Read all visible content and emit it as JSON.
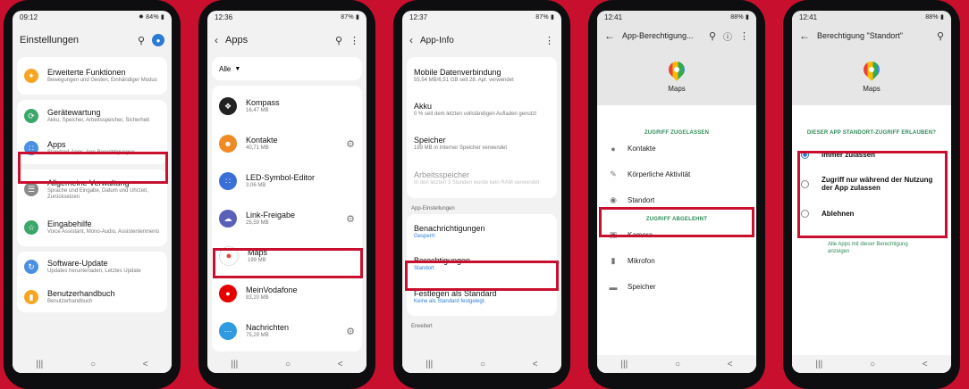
{
  "colors": {
    "frame": "#c8102e",
    "highlight": "#c8102e",
    "link": "#2b7bd6",
    "section_green": "#2e8b57"
  },
  "phone1": {
    "status": {
      "time": "09:12",
      "right": "✹ 84% ▮"
    },
    "title": "Einstellungen",
    "items": [
      {
        "title": "Erweiterte Funktionen",
        "sub": "Bewegungen und Gesten, Einhändiger Modus",
        "icon": "star-icon"
      },
      {
        "title": "Gerätewartung",
        "sub": "Akku, Speicher, Arbeitsspeicher, Sicherheit",
        "icon": "maintenance-icon"
      },
      {
        "title": "Apps",
        "sub": "Standard-Apps, App-Berechtigungen",
        "icon": "apps-grid-icon"
      },
      {
        "title": "Allgemeine Verwaltung",
        "sub": "Sprache und Eingabe, Datum und Uhrzeit, Zurücksetzen",
        "icon": "sliders-icon"
      },
      {
        "title": "Eingabehilfe",
        "sub": "Voice Assistant, Mono-Audio, Assistentenmenü",
        "icon": "accessibility-icon"
      },
      {
        "title": "Software-Update",
        "sub": "Updates herunterladen, Letztes Update",
        "icon": "update-icon"
      },
      {
        "title": "Benutzerhandbuch",
        "sub": "Benutzerhandbuch",
        "icon": "manual-icon"
      }
    ]
  },
  "phone2": {
    "status": {
      "time": "12:36",
      "right": "87% ▮"
    },
    "title": "Apps",
    "filter": "Alle",
    "apps": [
      {
        "name": "Kompass",
        "size": "16,47 MB"
      },
      {
        "name": "Kontakte",
        "size": "40,71 MB"
      },
      {
        "name": "LED-Symbol-Editor",
        "size": "3,06 MB"
      },
      {
        "name": "Link-Freigabe",
        "size": "25,59 MB"
      },
      {
        "name": "Maps",
        "size": "199 MB"
      },
      {
        "name": "MeinVodafone",
        "size": "83,20 MB"
      },
      {
        "name": "Nachrichten",
        "size": "75,29 MB"
      }
    ]
  },
  "phone3": {
    "status": {
      "time": "12:37",
      "right": "87% ▮"
    },
    "title": "App-Info",
    "items_top": [
      {
        "title": "Mobile Datenverbindung",
        "sub": "55,54 MB/6,51 GB seit 28. Apr. verwendet"
      },
      {
        "title": "Akku",
        "sub": "0 % seit dem letzten vollständigen Aufladen genutzt"
      },
      {
        "title": "Speicher",
        "sub": "199 MB in Interner Speicher verwendet"
      },
      {
        "title": "Arbeitsspeicher",
        "sub": "In den letzten 3 Stunden wurde kein RAM verwendet"
      }
    ],
    "section_settings": "App-Einstellungen",
    "items_settings": [
      {
        "title": "Benachrichtigungen",
        "sub": "Gesperrt"
      },
      {
        "title": "Berechtigungen",
        "sub": "Standort"
      },
      {
        "title": "Festlegen als Standard",
        "sub": "Keine als Standard festgelegt."
      }
    ],
    "section_advanced": "Erweitert"
  },
  "phone4": {
    "status": {
      "time": "12:41",
      "right": "88% ▮"
    },
    "title": "App-Berechtigung...",
    "app_name": "Maps",
    "section_allowed": "ZUGRIFF ZUGELASSEN",
    "allowed": [
      {
        "label": "Kontakte",
        "icon": "person-icon"
      },
      {
        "label": "Körperliche Aktivität",
        "icon": "activity-icon"
      },
      {
        "label": "Standort",
        "icon": "location-icon"
      }
    ],
    "section_denied": "ZUGRIFF ABGELEHNT",
    "denied": [
      {
        "label": "Kamera",
        "icon": "camera-icon"
      },
      {
        "label": "Mikrofon",
        "icon": "microphone-icon"
      },
      {
        "label": "Speicher",
        "icon": "folder-icon"
      }
    ]
  },
  "phone5": {
    "status": {
      "time": "12:41",
      "right": "88% ▮"
    },
    "title": "Berechtigung \"Standort\"",
    "app_name": "Maps",
    "question": "DIESER APP STANDORT-ZUGRIFF ERLAUBEN?",
    "options": [
      "Immer zulassen",
      "Zugriff nur während der Nutzung der App zulassen",
      "Ablehnen"
    ],
    "selected_index": 0,
    "link": "Alle Apps mit dieser Berechtigung anzeigen"
  },
  "nav": {
    "recent": "|||",
    "home": "○",
    "back": "<"
  }
}
